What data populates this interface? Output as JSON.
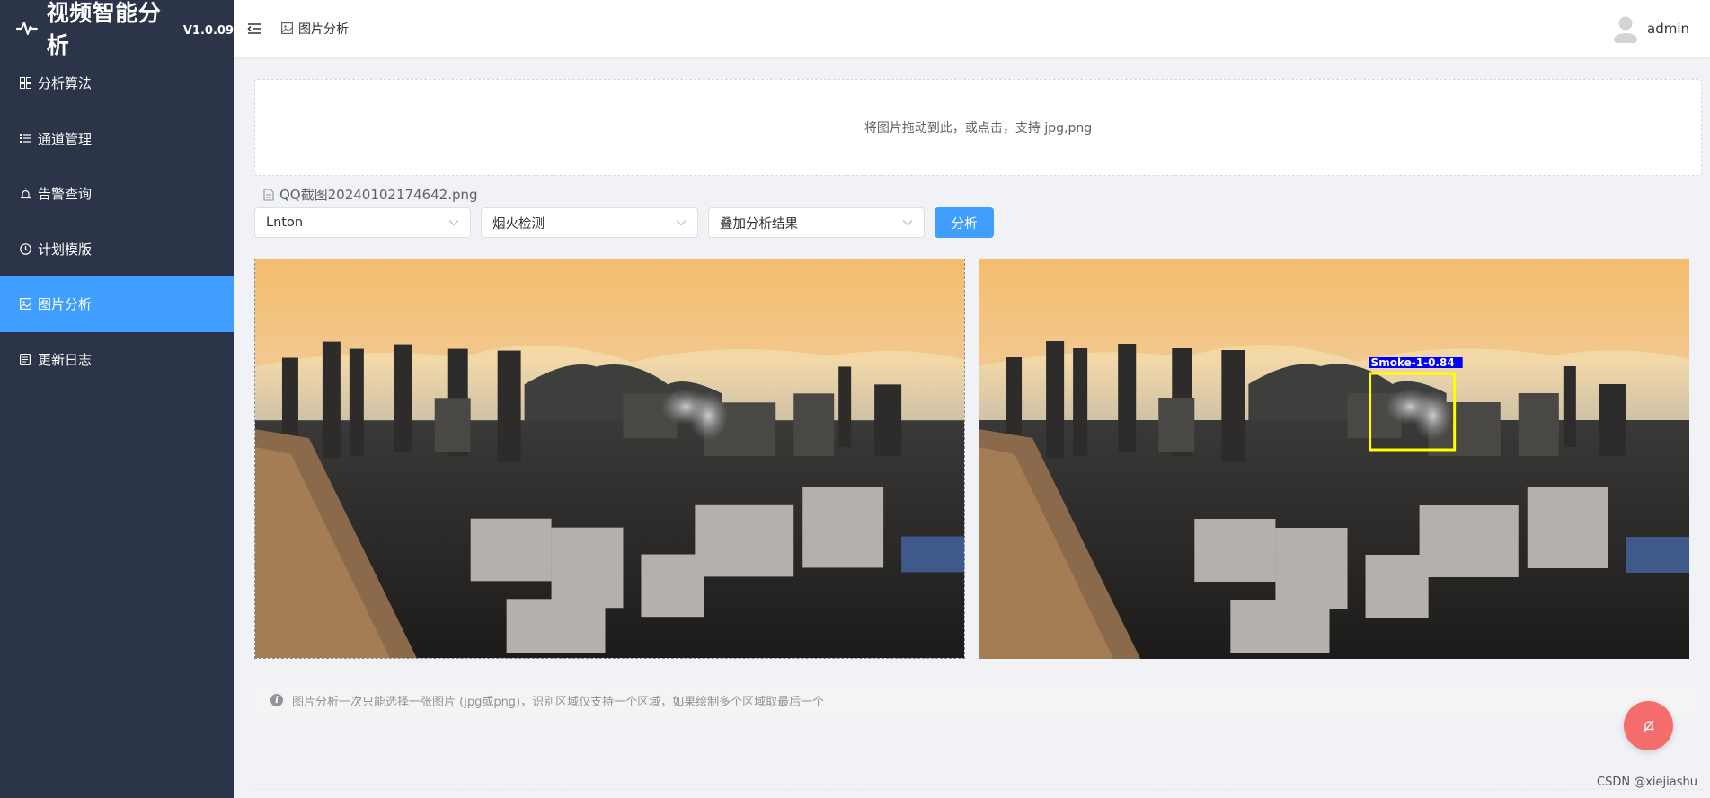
{
  "app": {
    "title": "视频智能分析",
    "version": "V1.0.09"
  },
  "sidebar": {
    "items": [
      {
        "label": "分析算法",
        "icon": "grid-icon"
      },
      {
        "label": "通道管理",
        "icon": "list-icon"
      },
      {
        "label": "告警查询",
        "icon": "alarm-icon"
      },
      {
        "label": "计划模版",
        "icon": "clock-icon"
      },
      {
        "label": "图片分析",
        "icon": "picture-icon",
        "active": true
      },
      {
        "label": "更新日志",
        "icon": "document-icon"
      }
    ]
  },
  "header": {
    "breadcrumb": "图片分析",
    "username": "admin"
  },
  "upload": {
    "hint": "将图片拖动到此，或点击，支持 jpg,png"
  },
  "file": {
    "name": "QQ截图20240102174642.png"
  },
  "controls": {
    "server_value": "Lnton",
    "algorithm_value": "烟火检测",
    "overlay_value": "叠加分析结果",
    "analyze_label": "分析"
  },
  "result": {
    "detection_label": "Smoke-1-0.84"
  },
  "tip": {
    "text": "图片分析一次只能选择一张图片 (jpg或png)，识别区域仅支持一个区域，如果绘制多个区域取最后一个"
  },
  "watermark": "CSDN @xiejiashu",
  "colors": {
    "sidebar_bg": "#2b3448",
    "accent": "#409eff",
    "fab": "#f56c6c",
    "detection_box": "#ffff00",
    "detection_label_bg": "#0000ff"
  }
}
